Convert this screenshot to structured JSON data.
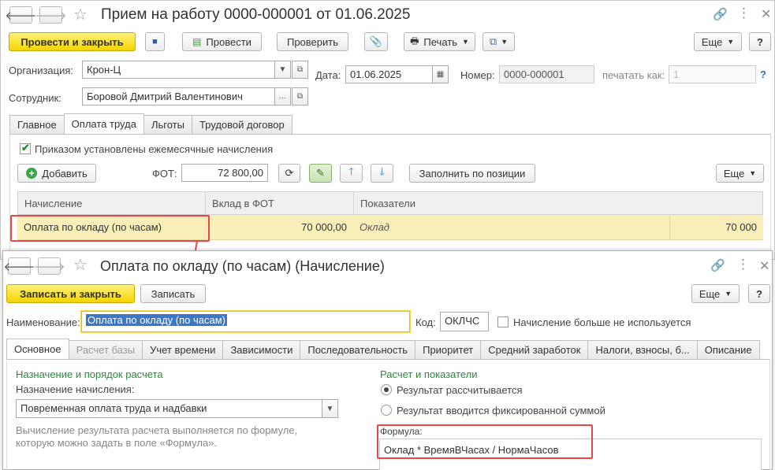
{
  "doc": {
    "title": "Прием на работу 0000-000001 от 01.06.2025",
    "toolbar": {
      "post_close": "Провести и закрыть",
      "post": "Провести",
      "check": "Проверить",
      "print": "Печать",
      "more": "Еще",
      "help": "?"
    },
    "org_label": "Организация:",
    "org_value": "Крон-Ц",
    "date_label": "Дата:",
    "date_value": "01.06.2025",
    "number_label": "Номер:",
    "number_value": "0000-000001",
    "print_as_label": "печатать как:",
    "print_as_value": "1",
    "help_q": "?",
    "employee_label": "Сотрудник:",
    "employee_value": "Боровой Дмитрий Валентинович",
    "tabs": [
      "Главное",
      "Оплата труда",
      "Льготы",
      "Трудовой договор"
    ],
    "monthly_checkbox": "Приказом установлены ежемесячные начисления",
    "add_button": "Добавить",
    "fot_label": "ФОТ:",
    "fot_value": "72 800,00",
    "fill_button": "Заполнить по позиции",
    "more": "Еще",
    "grid": {
      "headers": [
        "Начисление",
        "Вклад в ФОТ",
        "Показатели"
      ],
      "row": {
        "accrual": "Оплата по окладу (по часам)",
        "contribution": "70 000,00",
        "indicator": "Оклад",
        "value": "70 000"
      }
    }
  },
  "accrual": {
    "title": "Оплата по окладу (по часам) (Начисление)",
    "save_close": "Записать и закрыть",
    "save": "Записать",
    "more": "Еще",
    "help": "?",
    "name_label": "Наименование:",
    "name_value": "Оплата по окладу (по часам)",
    "code_label": "Код:",
    "code_value": "ОКЛЧС",
    "unused_checkbox": "Начисление больше не используется",
    "tabs": [
      "Основное",
      "Расчет базы",
      "Учет времени",
      "Зависимости",
      "Последовательность",
      "Приоритет",
      "Средний заработок",
      "Налоги, взносы, б...",
      "Описание"
    ],
    "section_left": "Назначение и порядок расчета",
    "purpose_label": "Назначение начисления:",
    "purpose_value": "Повременная оплата труда и надбавки",
    "note": "Вычисление результата расчета выполняется по формуле, которую можно задать в поле «Формула».",
    "section_right": "Расчет и показатели",
    "radio_calc": "Результат рассчитывается",
    "radio_fixed": "Результат вводится фиксированной суммой",
    "formula_label": "Формула:",
    "formula_value": "Оклад * ВремяВЧасах / НормаЧасов"
  }
}
